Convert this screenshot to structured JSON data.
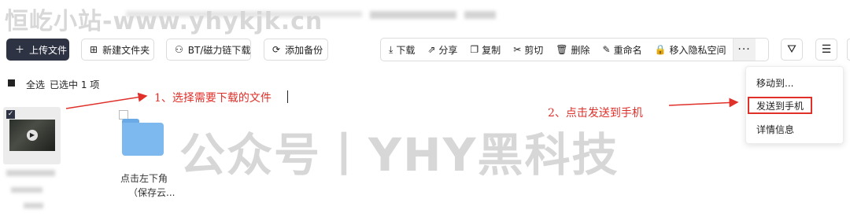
{
  "watermark_top": "恒屹小站-www.yhykjk.cn",
  "watermark_center": "公众号丨YHY黑科技",
  "toolbar": {
    "upload": "上传文件",
    "new_folder": "新建文件夹",
    "bt_download": "BT/磁力链下载",
    "add_backup": "添加备份",
    "download": "下载",
    "share": "分享",
    "copy": "复制",
    "cut": "剪切",
    "delete": "删除",
    "rename": "重命名",
    "move_private": "移入隐私空间",
    "more": "···"
  },
  "selection": {
    "select_all": "全选",
    "selected_count": "已选中 1 项"
  },
  "menu": {
    "move_to": "移动到...",
    "send_to_phone": "发送到手机",
    "details": "详情信息"
  },
  "annotations": {
    "step1": "1、选择需要下载的文件",
    "step2": "2、点击发送到手机"
  },
  "files": [
    {
      "name": "点击左下角",
      "name2": "（保存云..."
    }
  ],
  "colors": {
    "primary_button": "#2e3344",
    "annotation_red": "#e0302a",
    "folder_blue": "#7db8ef"
  }
}
